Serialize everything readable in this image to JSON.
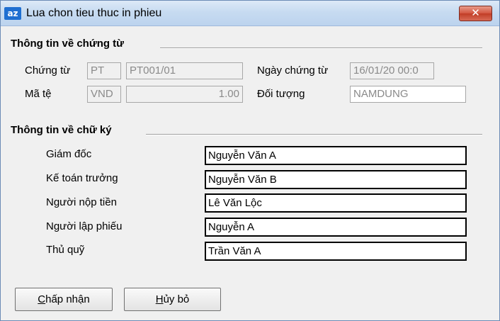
{
  "window": {
    "title": "Lua chon tieu thuc in phieu",
    "app_icon_text": "az",
    "close_symbol": "✕"
  },
  "document_section": {
    "title": "Thông tin về chứng từ",
    "voucher_label": "Chứng từ",
    "voucher_type": "PT",
    "voucher_number": "PT001/01",
    "voucher_date_label": "Ngày chứng từ",
    "voucher_date": "16/01/20 00:0",
    "currency_label": "Mã tệ",
    "currency_code": "VND",
    "exchange_rate": "1.00",
    "subject_label": "Đối tượng",
    "subject_value": "NAMDUNG"
  },
  "signature_section": {
    "title": "Thông tin về chữ ký",
    "rows": [
      {
        "label": "Giám đốc",
        "value": "Nguyễn Văn A"
      },
      {
        "label": "Kế toán trưởng",
        "value": "Nguyễn Văn B"
      },
      {
        "label": "Người nộp tiền",
        "value": "Lê Văn Lộc"
      },
      {
        "label": "Người lập phiếu",
        "value": "Nguyễn A"
      },
      {
        "label": "Thủ quỹ",
        "value": "Trần Văn A"
      }
    ]
  },
  "buttons": {
    "accept_hotkey": "C",
    "accept_rest": "hấp nhận",
    "cancel_hotkey": "H",
    "cancel_rest": "ủy bỏ"
  }
}
